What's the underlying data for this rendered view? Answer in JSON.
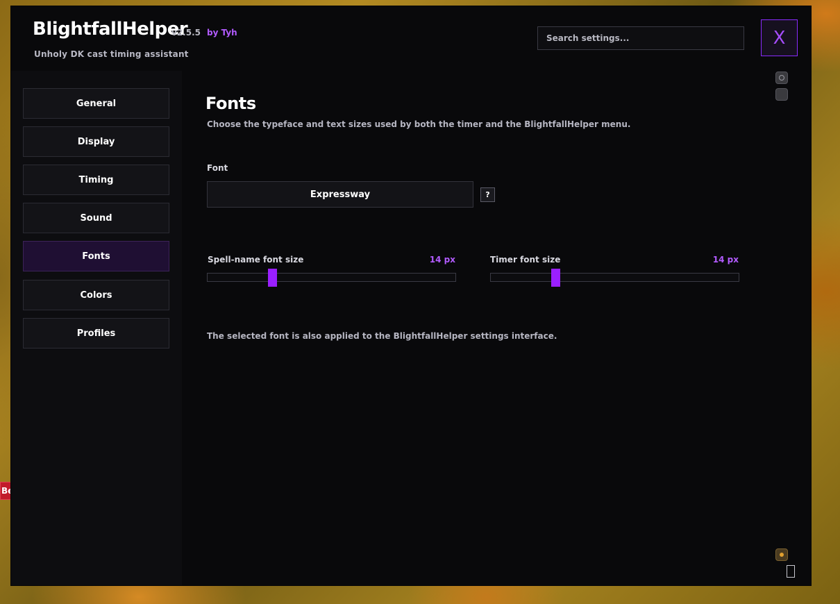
{
  "header": {
    "title": "BlightfallHelper",
    "version": "v2.5.5",
    "author": "by Tyh",
    "subtitle": "Unholy DK cast timing assistant",
    "search_placeholder": "Search settings...",
    "close_label": "X"
  },
  "sidebar": {
    "items": [
      {
        "label": "General",
        "active": false
      },
      {
        "label": "Display",
        "active": false
      },
      {
        "label": "Timing",
        "active": false
      },
      {
        "label": "Sound",
        "active": false
      },
      {
        "label": "Fonts",
        "active": true
      },
      {
        "label": "Colors",
        "active": false
      },
      {
        "label": "Profiles",
        "active": false
      }
    ]
  },
  "main": {
    "title": "Fonts",
    "description": "Choose the typeface and text sizes used by both the timer and the BlightfallHelper menu.",
    "font_label": "Font",
    "font_value": "Expressway",
    "help_label": "?",
    "sliders": [
      {
        "label": "Spell-name font size",
        "value_text": "14 px",
        "fraction": 0.26
      },
      {
        "label": "Timer font size",
        "value_text": "14 px",
        "fraction": 0.26
      }
    ],
    "note": "The selected font is also applied to the BlightfallHelper settings interface."
  },
  "background": {
    "edge_tab_text": "Be"
  },
  "colors": {
    "accent": "#9a1fff",
    "accent_text": "#b25bff",
    "panel_bg": "#0b0b0d",
    "active_nav_bg": "#1f0f33"
  },
  "icons": [
    "eye-icon",
    "square-icon",
    "lock-icon",
    "resize-handle-icon"
  ]
}
